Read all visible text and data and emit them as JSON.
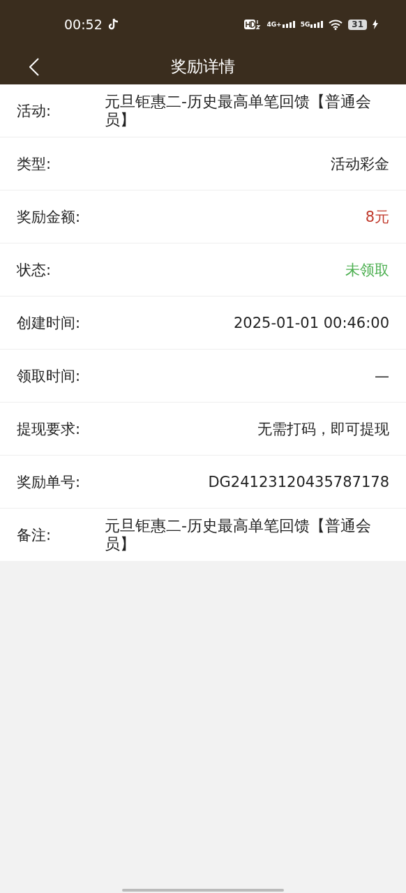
{
  "status_bar": {
    "time": "00:52",
    "network_1": "4G+",
    "network_2": "5G",
    "battery": "31"
  },
  "header": {
    "title": "奖励详情"
  },
  "rows": [
    {
      "kind": "block",
      "label": "活动:",
      "value": "元旦钜惠二-历史最高单笔回馈【普通会员】",
      "color": "#222222"
    },
    {
      "kind": "inline",
      "label": "类型:",
      "value": "活动彩金",
      "color": "#222222"
    },
    {
      "kind": "inline",
      "label": "奖励金额:",
      "value": "8元",
      "color": "#c0392b"
    },
    {
      "kind": "inline",
      "label": "状态:",
      "value": "未领取",
      "color": "#4caf50"
    },
    {
      "kind": "inline",
      "label": "创建时间:",
      "value": "2025-01-01 00:46:00",
      "color": "#222222"
    },
    {
      "kind": "inline",
      "label": "领取时间:",
      "value": "—",
      "color": "#222222"
    },
    {
      "kind": "inline",
      "label": "提现要求:",
      "value": "无需打码，即可提现",
      "color": "#222222"
    },
    {
      "kind": "inline",
      "label": "奖励单号:",
      "value": "DG24123120435787178",
      "color": "#222222"
    },
    {
      "kind": "block",
      "label": "备注:",
      "value": "元旦钜惠二-历史最高单笔回馈【普通会员】",
      "color": "#222222"
    }
  ]
}
